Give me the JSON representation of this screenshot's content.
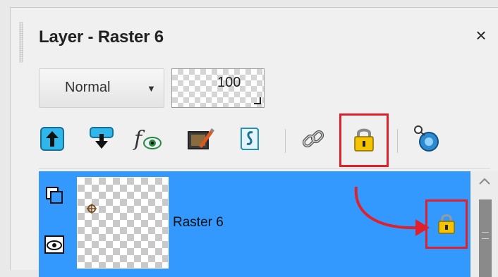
{
  "panel": {
    "title": "Layer - Raster 6",
    "close_glyph": "×"
  },
  "controls": {
    "blend_mode": "Normal",
    "opacity_value": "100"
  },
  "toolbar": {
    "icons": [
      "move-layer-up-icon",
      "move-layer-down-icon",
      "layer-effects-icon",
      "edit-layer-icon",
      "layer-script-icon",
      "link-layers-icon",
      "lock-layer-icon",
      "layer-target-icon"
    ]
  },
  "layer": {
    "name": "Raster 6",
    "locked": true
  },
  "colors": {
    "selection": "#3399ff",
    "callout": "#e0202b",
    "lock": "#f5c400"
  }
}
